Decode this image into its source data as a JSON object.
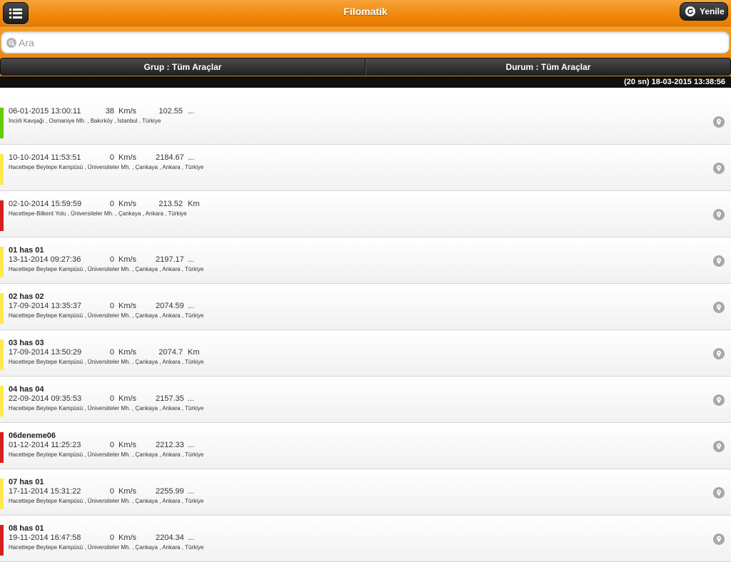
{
  "header": {
    "title": "Filomatik",
    "refresh_label": "Yenile"
  },
  "search": {
    "placeholder": "Ara",
    "value": ""
  },
  "filters": {
    "group_label": "Grup : Tüm Araçlar",
    "status_label": "Durum : Tüm Araçlar"
  },
  "update_status": "(20 sn) 18-03-2015 13:38:56",
  "colors": {
    "accent": "#f08a0c",
    "green": "#66cc00",
    "yellow": "#ffe84d",
    "red": "#d62020"
  },
  "vehicles": [
    {
      "name": "",
      "status": "green",
      "datetime": "06-01-2015 13:00:11",
      "speed": "38",
      "speed_unit": "Km/s",
      "odometer": "102.55",
      "odometer_unit": "...",
      "address": "İncirli Kavşağı , Osmaniye Mh. , Bakırköy , İstanbul , Türkiye"
    },
    {
      "name": "",
      "status": "yellow",
      "datetime": "10-10-2014 11:53:51",
      "speed": "0",
      "speed_unit": "Km/s",
      "odometer": "2184.67",
      "odometer_unit": "...",
      "address": "Hacettepe Beytepe Kampüsü , Üniversiteler Mh. , Çankaya , Ankara , Türkiye"
    },
    {
      "name": "",
      "status": "red",
      "datetime": "02-10-2014 15:59:59",
      "speed": "0",
      "speed_unit": "Km/s",
      "odometer": "213.52",
      "odometer_unit": "Km",
      "address": "Hacettepe-Bilkent Yolu , Üniversiteler Mh. , Çankaya , Ankara , Türkiye"
    },
    {
      "name": "01 has 01",
      "status": "yellow",
      "datetime": "13-11-2014 09:27:36",
      "speed": "0",
      "speed_unit": "Km/s",
      "odometer": "2197.17",
      "odometer_unit": "...",
      "address": "Hacettepe Beytepe Kampüsü , Üniversiteler Mh. , Çankaya , Ankara , Türkiye"
    },
    {
      "name": "02 has 02",
      "status": "yellow",
      "datetime": "17-09-2014 13:35:37",
      "speed": "0",
      "speed_unit": "Km/s",
      "odometer": "2074.59",
      "odometer_unit": "...",
      "address": "Hacettepe Beytepe Kampüsü , Üniversiteler Mh. , Çankaya , Ankara , Türkiye"
    },
    {
      "name": "03 has 03",
      "status": "yellow",
      "datetime": "17-09-2014 13:50:29",
      "speed": "0",
      "speed_unit": "Km/s",
      "odometer": "2074.7",
      "odometer_unit": "Km",
      "address": "Hacettepe Beytepe Kampüsü , Üniversiteler Mh. , Çankaya , Ankara , Türkiye"
    },
    {
      "name": "04 has 04",
      "status": "yellow",
      "datetime": "22-09-2014 09:35:53",
      "speed": "0",
      "speed_unit": "Km/s",
      "odometer": "2157.35",
      "odometer_unit": "...",
      "address": "Hacettepe Beytepe Kampüsü , Üniversiteler Mh. , Çankaya , Ankara , Türkiye"
    },
    {
      "name": "06deneme06",
      "status": "red",
      "datetime": "01-12-2014 11:25:23",
      "speed": "0",
      "speed_unit": "Km/s",
      "odometer": "2212.33",
      "odometer_unit": "...",
      "address": "Hacettepe Beytepe Kampüsü , Üniversiteler Mh. , Çankaya , Ankara , Türkiye"
    },
    {
      "name": "07 has 01",
      "status": "yellow",
      "datetime": "17-11-2014 15:31:22",
      "speed": "0",
      "speed_unit": "Km/s",
      "odometer": "2255.99",
      "odometer_unit": "...",
      "address": "Hacettepe Beytepe Kampüsü , Üniversiteler Mh. , Çankaya , Ankara , Türkiye"
    },
    {
      "name": "08 has 01",
      "status": "red",
      "datetime": "19-11-2014 16:47:58",
      "speed": "0",
      "speed_unit": "Km/s",
      "odometer": "2204.34",
      "odometer_unit": "...",
      "address": "Hacettepe Beytepe Kampüsü , Üniversiteler Mh. , Çankaya , Ankara , Türkiye"
    }
  ]
}
